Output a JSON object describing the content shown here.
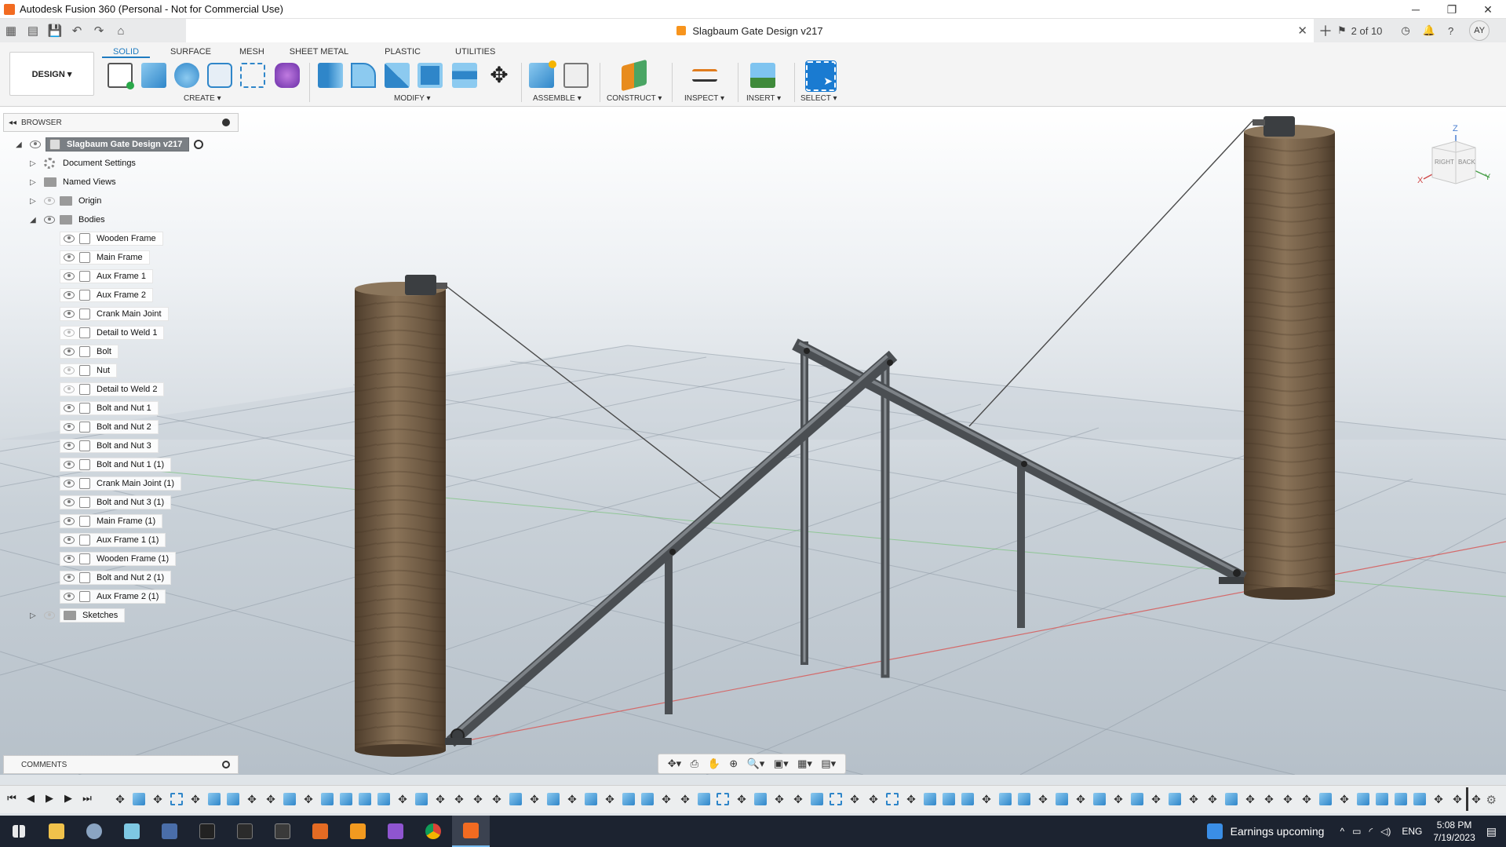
{
  "window": {
    "title": "Autodesk Fusion 360 (Personal - Not for Commercial Use)",
    "controls": [
      "─",
      "❐",
      "✕"
    ]
  },
  "document_tab": {
    "title": "Slagbaum Gate Design v217",
    "close": "✕",
    "page_counter": "2 of 10"
  },
  "user": {
    "initials": "AY"
  },
  "ribbon": {
    "workspace_button": "DESIGN ▾",
    "tabs": [
      "SOLID",
      "SURFACE",
      "MESH",
      "SHEET METAL",
      "PLASTIC",
      "UTILITIES"
    ],
    "active_tab": "SOLID",
    "groups": {
      "create": "CREATE ▾",
      "modify": "MODIFY ▾",
      "assemble": "ASSEMBLE ▾",
      "construct": "CONSTRUCT ▾",
      "inspect": "INSPECT ▾",
      "insert": "INSERT ▾",
      "select": "SELECT ▾"
    }
  },
  "browser": {
    "header": "BROWSER",
    "root": "Slagbaum Gate Design v217",
    "folders": {
      "document_settings": "Document Settings",
      "named_views": "Named Views",
      "origin": "Origin",
      "bodies": "Bodies",
      "sketches": "Sketches"
    },
    "bodies": [
      {
        "name": "Wooden Frame",
        "visible": true
      },
      {
        "name": "Main Frame",
        "visible": true
      },
      {
        "name": "Aux Frame 1",
        "visible": true
      },
      {
        "name": "Aux Frame 2",
        "visible": true
      },
      {
        "name": "Crank Main Joint",
        "visible": true
      },
      {
        "name": "Detail to Weld 1",
        "visible": false
      },
      {
        "name": "Bolt",
        "visible": true
      },
      {
        "name": "Nut",
        "visible": false
      },
      {
        "name": "Detail to Weld 2",
        "visible": false
      },
      {
        "name": "Bolt and Nut 1",
        "visible": true
      },
      {
        "name": "Bolt and Nut 2",
        "visible": true
      },
      {
        "name": "Bolt and Nut 3",
        "visible": true
      },
      {
        "name": "Bolt and Nut 1 (1)",
        "visible": true
      },
      {
        "name": "Crank Main Joint (1)",
        "visible": true
      },
      {
        "name": "Bolt and Nut 3 (1)",
        "visible": true
      },
      {
        "name": "Main Frame (1)",
        "visible": true
      },
      {
        "name": "Aux Frame 1 (1)",
        "visible": true
      },
      {
        "name": "Wooden Frame (1)",
        "visible": true
      },
      {
        "name": "Bolt and Nut 2 (1)",
        "visible": true
      },
      {
        "name": "Aux Frame 2 (1)",
        "visible": true
      }
    ]
  },
  "comments": {
    "label": "COMMENTS"
  },
  "viewcube": {
    "right": "RIGHT",
    "back": "BACK",
    "z": "Z",
    "x": "X",
    "y": "Y"
  },
  "navbar": [
    "✥▾",
    "⎙",
    "✋",
    "⊕",
    "🔍▾",
    "▣▾",
    "▦▾",
    "▤▾"
  ],
  "timeline": {
    "controls": [
      "⏮",
      "◀",
      "▶",
      "▶",
      "⏭"
    ],
    "settings": "⚙",
    "items": [
      "move",
      "box",
      "move",
      "sketch",
      "move",
      "box",
      "box",
      "move",
      "move",
      "box",
      "move",
      "box",
      "box",
      "box",
      "box",
      "move",
      "box",
      "move",
      "move",
      "move",
      "move",
      "box",
      "move",
      "box",
      "move",
      "box",
      "move",
      "box",
      "box",
      "move",
      "move",
      "box",
      "sketch",
      "move",
      "box",
      "move",
      "move",
      "box",
      "sketch",
      "move",
      "move",
      "sketch",
      "move",
      "box",
      "box",
      "box",
      "move",
      "box",
      "box",
      "move",
      "box",
      "move",
      "box",
      "move",
      "box",
      "move",
      "box",
      "move",
      "move",
      "box",
      "move",
      "move",
      "move",
      "move",
      "box",
      "move",
      "box",
      "box",
      "box",
      "box",
      "move",
      "move",
      "move"
    ]
  },
  "taskbar": {
    "news": "Earnings upcoming",
    "lang": "ENG",
    "time": "5:08 PM",
    "date": "7/19/2023",
    "tray_arrow": "^"
  },
  "colors": {
    "accent": "#1f7bc0",
    "app_orange": "#f26b21",
    "taskbar": "#1c2330",
    "wood": "#6f5a45",
    "steel": "#5e6266"
  }
}
